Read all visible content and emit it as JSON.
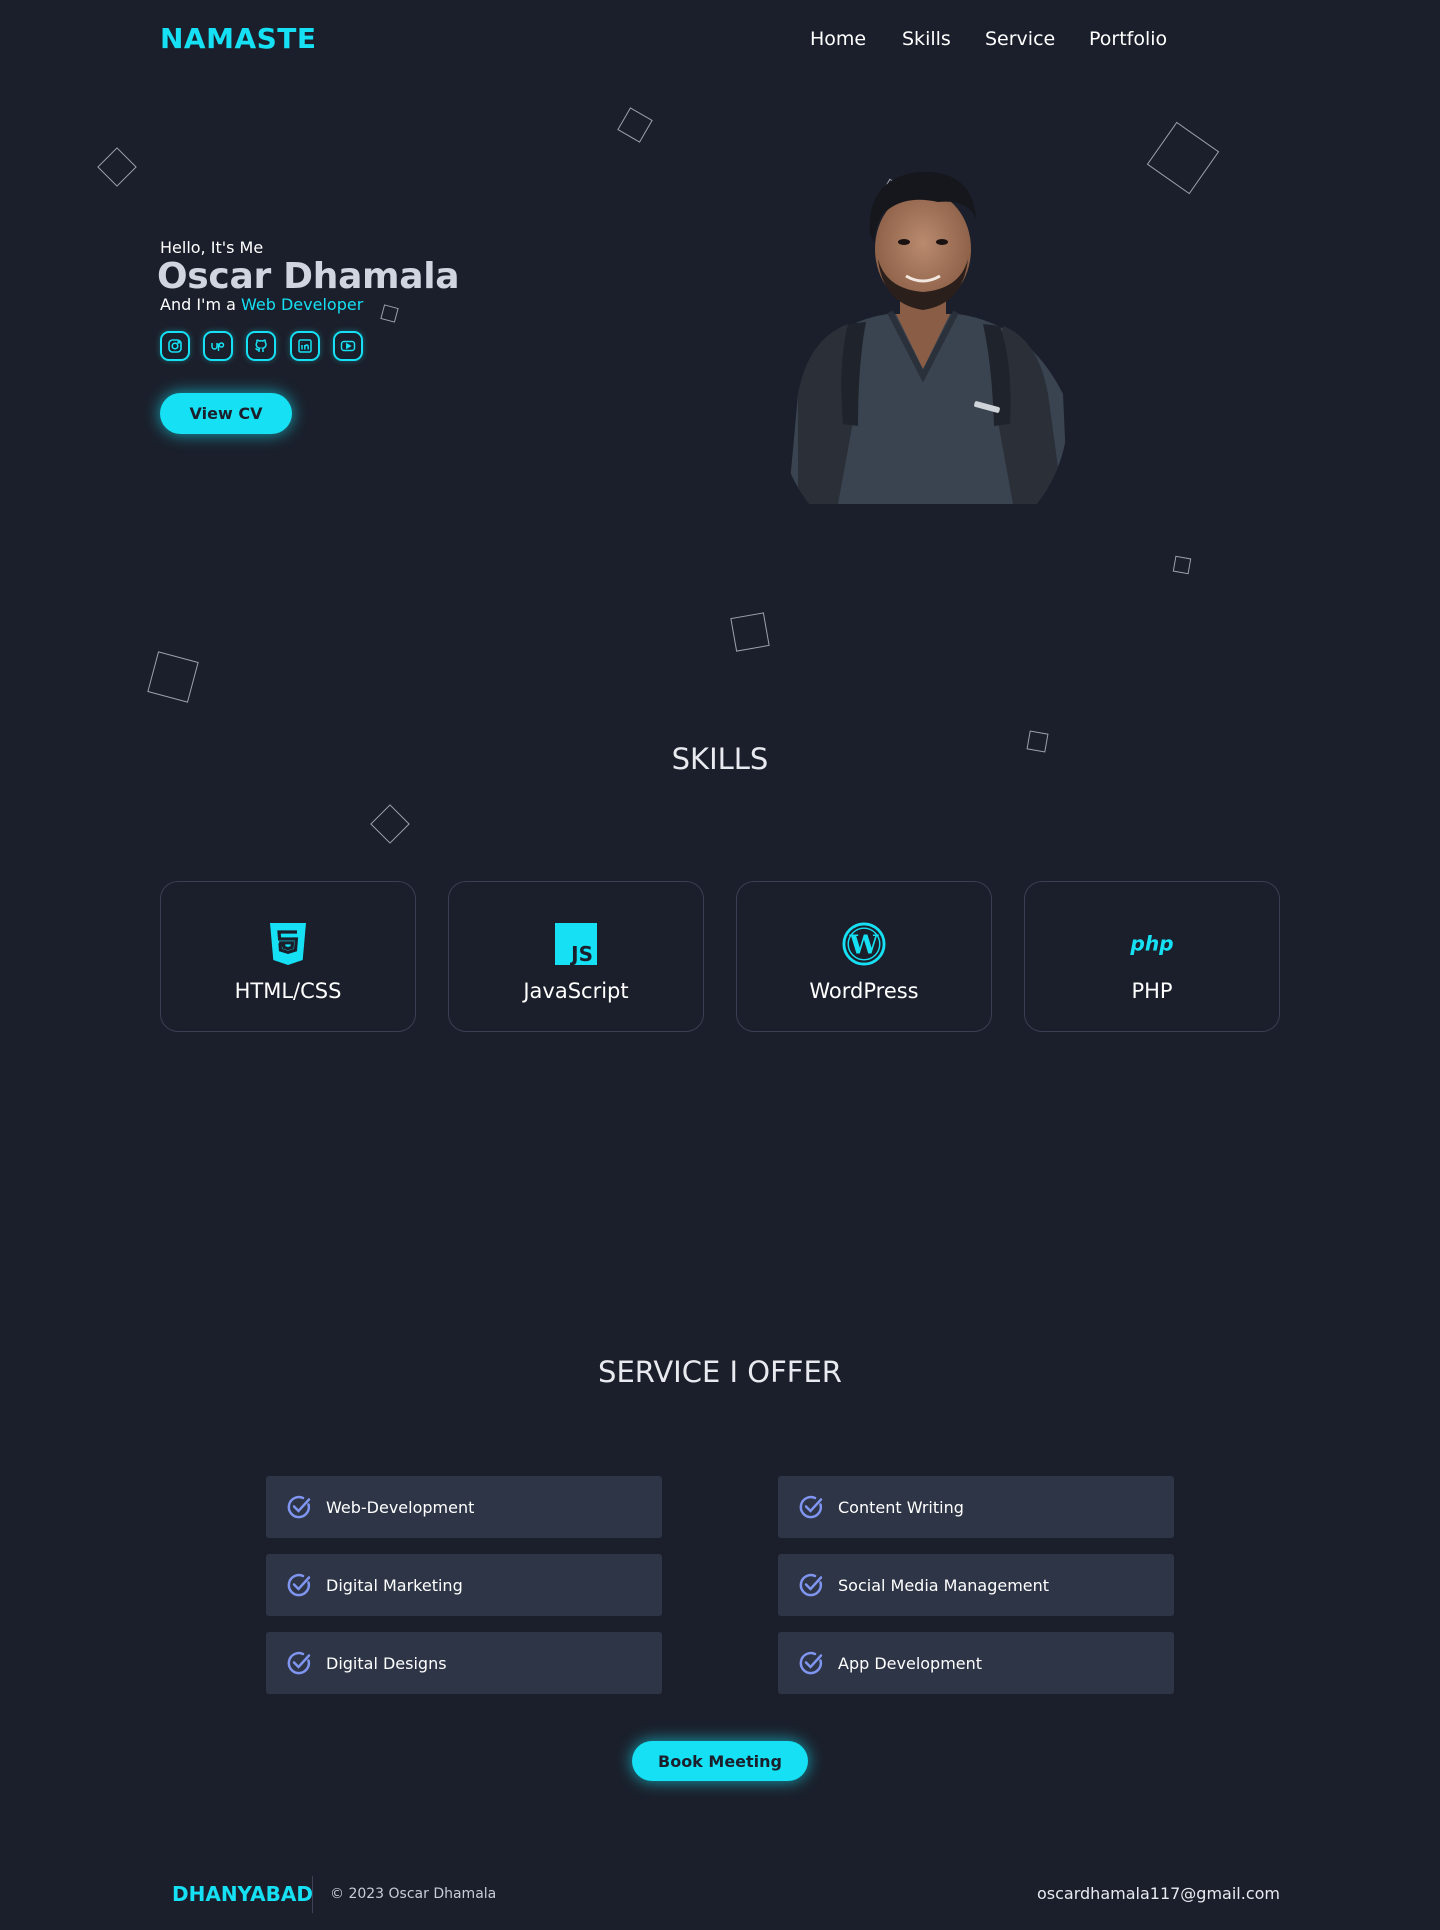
{
  "header": {
    "logo": "NAMASTE",
    "nav": [
      "Home",
      "Skills",
      "Service",
      "Portfolio"
    ]
  },
  "hero": {
    "greeting": "Hello, It's Me",
    "name": "Oscar Dhamala",
    "role_prefix": "And I'm a",
    "role_highlight": "Web Developer",
    "social_icons": [
      "instagram-icon",
      "upwork-icon",
      "github-icon",
      "linkedin-icon",
      "youtube-icon"
    ],
    "cv_button": "View CV"
  },
  "skills": {
    "title": "SKILLS",
    "items": [
      {
        "label": "HTML/CSS",
        "icon": "html5-icon"
      },
      {
        "label": "JavaScript",
        "icon": "javascript-icon"
      },
      {
        "label": "WordPress",
        "icon": "wordpress-icon"
      },
      {
        "label": "PHP",
        "icon": "php-icon"
      }
    ]
  },
  "services": {
    "title": "SERVICE I OFFER",
    "items": [
      "Web-Development",
      "Content Writing",
      "Digital Marketing",
      "Social Media Management",
      "Digital Designs",
      "App Development"
    ],
    "icon": "check-circle-icon",
    "book_button": "Book Meeting"
  },
  "footer": {
    "brand": "DHANYABAD",
    "copyright": "© 2023 Oscar Dhamala",
    "email": "oscardhamala117@gmail.com"
  },
  "colors": {
    "background": "#1b1f2b",
    "accent": "#16e0f3",
    "service_card": "#2e3546",
    "check_icon": "#7f95f0"
  }
}
